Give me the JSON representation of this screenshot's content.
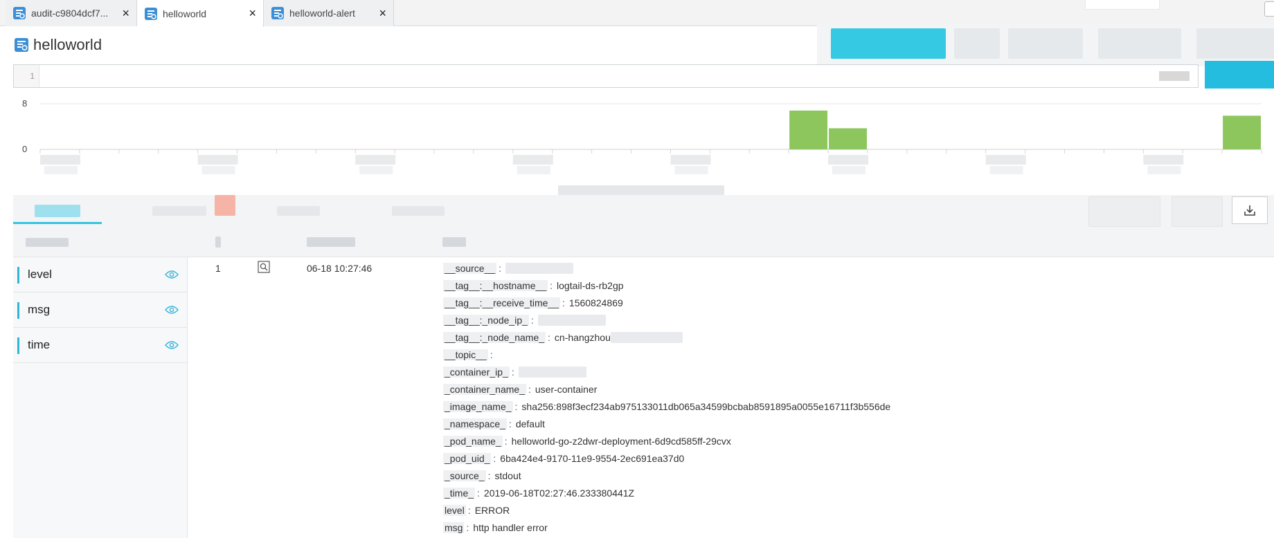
{
  "tabs": [
    {
      "label": "audit-c9804dcf7...",
      "active": false
    },
    {
      "label": "helloworld",
      "active": true
    },
    {
      "label": "helloworld-alert",
      "active": false
    }
  ],
  "logstore": {
    "title": "helloworld"
  },
  "query": {
    "line_number": "1",
    "text": ""
  },
  "histogram": {
    "y_ticks": [
      "8",
      "0"
    ],
    "chart_data": {
      "type": "bar",
      "ylim": [
        0,
        8
      ],
      "bars": [
        {
          "bin": 19,
          "value": 6.8
        },
        {
          "bin": 20,
          "value": 3.7
        },
        {
          "bin": 30,
          "value": 5.9
        }
      ]
    }
  },
  "fields": [
    {
      "name": "level"
    },
    {
      "name": "msg"
    },
    {
      "name": "time"
    }
  ],
  "log": {
    "index": "1",
    "time": "06-18 10:27:46",
    "entries": [
      {
        "key": "__source__",
        "value": "",
        "masked": true
      },
      {
        "key": "__tag__:__hostname__",
        "value": "logtail-ds-rb2gp"
      },
      {
        "key": "__tag__:__receive_time__",
        "value": "1560824869"
      },
      {
        "key": "__tag__:_node_ip_",
        "value": "",
        "masked": true
      },
      {
        "key": "__tag__:_node_name_",
        "value": "cn-hangzhou",
        "masked_suffix": true
      },
      {
        "key": "__topic__",
        "value": ""
      },
      {
        "key": "_container_ip_",
        "value": "",
        "masked": true
      },
      {
        "key": "_container_name_",
        "value": "user-container"
      },
      {
        "key": "_image_name_",
        "value": "sha256:898f3ecf234ab975133011db065a34599bcbab8591895a0055e16711f3b556de"
      },
      {
        "key": "_namespace_",
        "value": "default"
      },
      {
        "key": "_pod_name_",
        "value": "helloworld-go-z2dwr-deployment-6d9cd585ff-29cvx"
      },
      {
        "key": "_pod_uid_",
        "value": "6ba424e4-9170-11e9-9554-2ec691ea37d0"
      },
      {
        "key": "_source_",
        "value": "stdout"
      },
      {
        "key": "_time_",
        "value": "2019-06-18T02:27:46.233380441Z"
      },
      {
        "key": "level",
        "value": "ERROR"
      },
      {
        "key": "msg",
        "value": "http handler error"
      }
    ]
  },
  "colors": {
    "accent": "#24bde0",
    "bar": "#8cc65d",
    "field_bar": "#2fb6d6",
    "icon": "#3b8fd6"
  }
}
